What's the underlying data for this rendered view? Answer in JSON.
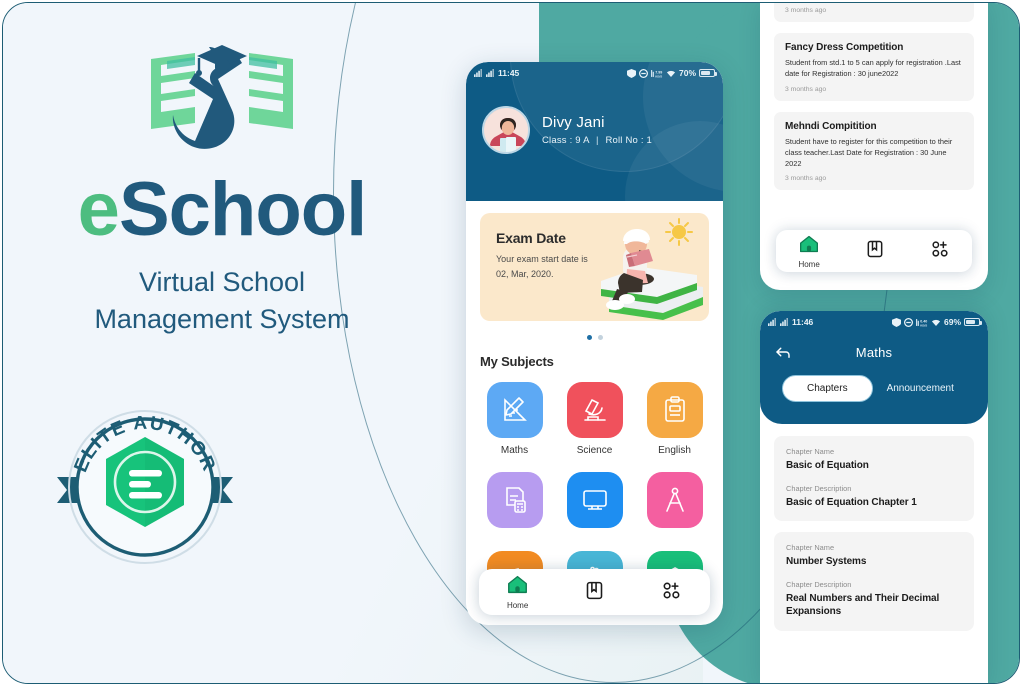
{
  "brand": {
    "logo_icon": "graduate-book-logo",
    "wordmark_prefix": "e",
    "wordmark_rest": "School",
    "tagline_line1": "Virtual School",
    "tagline_line2": "Management System",
    "badge": {
      "text": "ELITE AUTHOR",
      "icon": "envato-elite-badge-icon",
      "color_ring": "#1d5d74",
      "color_hex": "#17c37b"
    }
  },
  "colors": {
    "header_blue": "#0e5b85",
    "teal": "#4fa9a2",
    "page_bg": "#f1f6fb",
    "brand_green": "#4dbd80",
    "brand_blue": "#215a7d"
  },
  "phone_home": {
    "statusbar": {
      "time": "11:45",
      "battery": "70%",
      "icons": [
        "signal-icon",
        "signal-icon",
        "shield-icon",
        "dnd-icon",
        "data-speed-icon",
        "wifi-icon",
        "battery-icon"
      ]
    },
    "profile": {
      "name": "Divy Jani",
      "class_label": "Class : 9 A",
      "separator": "|",
      "roll_label": "Roll No : 1",
      "avatar_icon": "student-avatar"
    },
    "exam_card": {
      "title": "Exam Date",
      "line1": "Your exam start date is",
      "line2": "02, Mar, 2020.",
      "illustration": "student-on-books-illustration",
      "bg_hex": "#fbe8cb"
    },
    "carousel": {
      "total": 2,
      "active": 1
    },
    "section_title": "My Subjects",
    "subjects": [
      {
        "label": "Maths",
        "icon": "ruler-pencil-icon",
        "color": "#5da9f4"
      },
      {
        "label": "Science",
        "icon": "microscope-icon",
        "color": "#f0515c"
      },
      {
        "label": "English",
        "icon": "eng-notebook-icon",
        "color": "#f5a council"
      },
      {
        "label": "",
        "icon": "accounts-calculator-icon",
        "color": "#b79cf0"
      },
      {
        "label": "",
        "icon": "computer-monitor-icon",
        "color": "#1e8ef1"
      },
      {
        "label": "",
        "icon": "compass-geometry-icon",
        "color": "#f45fa0"
      },
      {
        "label": "",
        "icon": "music-notes-icon",
        "color": "#f28b22"
      },
      {
        "label": "",
        "icon": "hand-drawing-icon",
        "color": "#49b6d6"
      },
      {
        "label": "",
        "icon": "home-science-icon",
        "color": "#19bf7a"
      }
    ],
    "bottom_nav": [
      {
        "label": "Home",
        "icon": "home-icon",
        "active": true
      },
      {
        "label": "",
        "icon": "book-icon",
        "active": false
      },
      {
        "label": "",
        "icon": "apps-add-icon",
        "active": false
      }
    ]
  },
  "panel_notifications": {
    "cards": [
      {
        "title": "",
        "body": "",
        "time": "3 months ago",
        "partial": true
      },
      {
        "title": "Fancy Dress Competition",
        "body": "Student from std.1 to 5 can apply for registration .Last date for Registration : 30 june2022",
        "time": "3 months ago",
        "partial": false
      },
      {
        "title": "Mehndi Compitition",
        "body": "Student have to register for this competition to their class teacher.Last Date for Registration : 30 June 2022",
        "time": "3 months ago",
        "partial": false
      }
    ],
    "bottom_nav": [
      {
        "label": "Home",
        "icon": "home-icon",
        "active": true
      },
      {
        "label": "",
        "icon": "book-icon",
        "active": false
      },
      {
        "label": "",
        "icon": "apps-add-icon",
        "active": false
      }
    ]
  },
  "panel_maths": {
    "statusbar": {
      "time": "11:46",
      "battery": "69%"
    },
    "back_icon": "back-arrow-icon",
    "title": "Maths",
    "tabs": [
      {
        "label": "Chapters",
        "active": true
      },
      {
        "label": "Announcement",
        "active": false
      }
    ],
    "chapter_labels": {
      "name": "Chapter Name",
      "description": "Chapter Description"
    },
    "chapters": [
      {
        "name": "Basic of Equation",
        "description": "Basic of Equation Chapter 1"
      },
      {
        "name": "Number Systems",
        "description": "Real Numbers and Their Decimal Expansions"
      }
    ]
  }
}
